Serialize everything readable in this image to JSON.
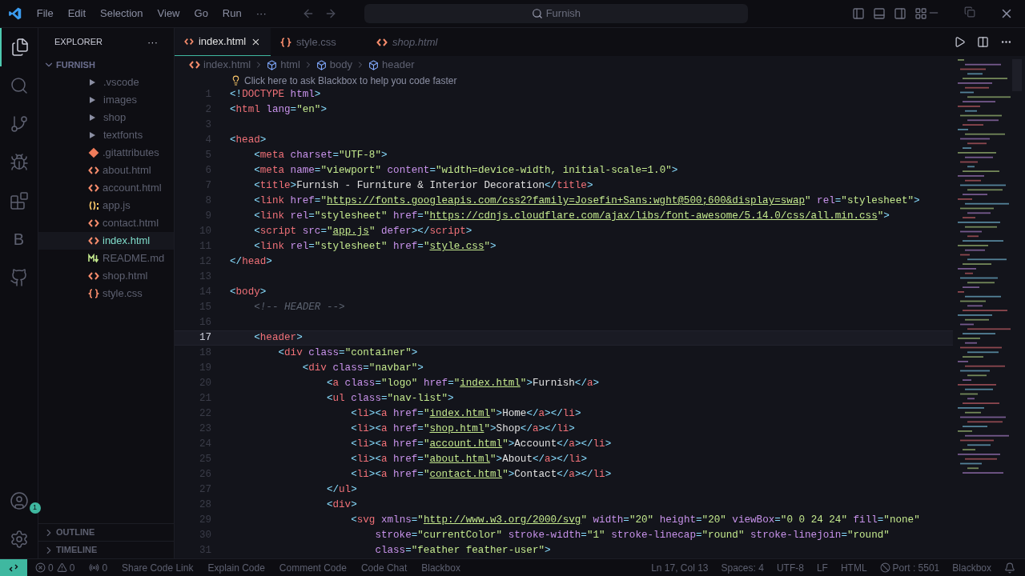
{
  "menu": [
    "File",
    "Edit",
    "Selection",
    "View",
    "Go",
    "Run",
    "···"
  ],
  "command_center": "Furnish",
  "activity": {
    "letter": "B",
    "badge": "1"
  },
  "sidebar": {
    "title": "EXPLORER",
    "more": "···",
    "root": {
      "label": "FURNISH",
      "expanded": true
    },
    "folders": [
      {
        "name": ".vscode",
        "expanded": false
      },
      {
        "name": "images",
        "expanded": false
      },
      {
        "name": "shop",
        "expanded": false
      },
      {
        "name": "textfonts",
        "expanded": false
      }
    ],
    "files": [
      {
        "name": ".gitattributes",
        "kind": "git",
        "selected": false
      },
      {
        "name": "about.html",
        "kind": "html",
        "selected": false
      },
      {
        "name": "account.html",
        "kind": "html",
        "selected": false
      },
      {
        "name": "app.js",
        "kind": "js",
        "selected": false
      },
      {
        "name": "contact.html",
        "kind": "html",
        "selected": false
      },
      {
        "name": "index.html",
        "kind": "html",
        "selected": true
      },
      {
        "name": "README.md",
        "kind": "md",
        "selected": false
      },
      {
        "name": "shop.html",
        "kind": "html",
        "selected": false
      },
      {
        "name": "style.css",
        "kind": "css",
        "selected": false
      }
    ],
    "sections": [
      {
        "label": "OUTLINE",
        "expanded": false
      },
      {
        "label": "TIMELINE",
        "expanded": false
      }
    ]
  },
  "tabs": [
    {
      "label": "index.html",
      "kind": "html",
      "selected": true,
      "preview": false
    },
    {
      "label": "style.css",
      "kind": "css",
      "selected": false,
      "preview": false
    },
    {
      "label": "shop.html",
      "kind": "html",
      "selected": false,
      "preview": true
    }
  ],
  "breadcrumb": [
    {
      "label": "index.html",
      "kind": "file"
    },
    {
      "label": "html",
      "kind": "element"
    },
    {
      "label": "body",
      "kind": "element"
    },
    {
      "label": "header",
      "kind": "element"
    }
  ],
  "hint": "Click here to ask Blackbox to help you code faster",
  "lines": [
    {
      "number": "1",
      "current": false,
      "tokens": [
        {
          "kind": "p",
          "text": "<!"
        },
        {
          "kind": "tag",
          "text": "DOCTYPE"
        },
        {
          "kind": "attr",
          "text": " html"
        },
        {
          "kind": "p",
          "text": ">"
        }
      ]
    },
    {
      "number": "2",
      "current": false,
      "tokens": [
        {
          "kind": "p",
          "text": "<"
        },
        {
          "kind": "tag",
          "text": "html"
        },
        {
          "kind": "attr",
          "text": " lang"
        },
        {
          "kind": "p",
          "text": "="
        },
        {
          "kind": "str",
          "text": "\"en\""
        },
        {
          "kind": "p",
          "text": ">"
        }
      ]
    },
    {
      "number": "3",
      "current": false
    },
    {
      "number": "4",
      "current": false,
      "tokens": [
        {
          "kind": "p",
          "text": "<"
        },
        {
          "kind": "tag",
          "text": "head"
        },
        {
          "kind": "p",
          "text": ">"
        }
      ]
    },
    {
      "number": "5",
      "current": false,
      "tokens": [
        {
          "kind": "p",
          "text": "    <"
        },
        {
          "kind": "tag",
          "text": "meta"
        },
        {
          "kind": "attr",
          "text": " charset"
        },
        {
          "kind": "p",
          "text": "="
        },
        {
          "kind": "str",
          "text": "\"UTF-8\""
        },
        {
          "kind": "p",
          "text": ">"
        }
      ]
    },
    {
      "number": "6",
      "current": false,
      "tokens": [
        {
          "kind": "p",
          "text": "    <"
        },
        {
          "kind": "tag",
          "text": "meta"
        },
        {
          "kind": "attr",
          "text": " name"
        },
        {
          "kind": "p",
          "text": "="
        },
        {
          "kind": "str",
          "text": "\"viewport\""
        },
        {
          "kind": "attr",
          "text": " content"
        },
        {
          "kind": "p",
          "text": "="
        },
        {
          "kind": "str",
          "text": "\"width=device-width, initial-scale=1.0\""
        },
        {
          "kind": "p",
          "text": ">"
        }
      ]
    },
    {
      "number": "7",
      "current": false,
      "tokens": [
        {
          "kind": "p",
          "text": "    <"
        },
        {
          "kind": "tag",
          "text": "title"
        },
        {
          "kind": "p",
          "text": ">"
        },
        {
          "kind": "text",
          "text": "Furnish - Furniture & Interior Decoration"
        },
        {
          "kind": "p",
          "text": "</"
        },
        {
          "kind": "tag",
          "text": "title"
        },
        {
          "kind": "p",
          "text": ">"
        }
      ]
    },
    {
      "number": "8",
      "current": false,
      "tokens": [
        {
          "kind": "p",
          "text": "    <"
        },
        {
          "kind": "tag",
          "text": "link"
        },
        {
          "kind": "attr",
          "text": " href"
        },
        {
          "kind": "p",
          "text": "="
        },
        {
          "kind": "str",
          "text": "\""
        },
        {
          "kind": "link",
          "text": "https://fonts.googleapis.com/css2?family=Josefin+Sans:wght@500;600&display=swap"
        },
        {
          "kind": "str",
          "text": "\""
        },
        {
          "kind": "attr",
          "text": " rel"
        },
        {
          "kind": "p",
          "text": "="
        },
        {
          "kind": "str",
          "text": "\"stylesheet\""
        },
        {
          "kind": "p",
          "text": ">"
        }
      ]
    },
    {
      "number": "9",
      "current": false,
      "tokens": [
        {
          "kind": "p",
          "text": "    <"
        },
        {
          "kind": "tag",
          "text": "link"
        },
        {
          "kind": "attr",
          "text": " rel"
        },
        {
          "kind": "p",
          "text": "="
        },
        {
          "kind": "str",
          "text": "\"stylesheet\""
        },
        {
          "kind": "attr",
          "text": " href"
        },
        {
          "kind": "p",
          "text": "="
        },
        {
          "kind": "str",
          "text": "\""
        },
        {
          "kind": "link",
          "text": "https://cdnjs.cloudflare.com/ajax/libs/font-awesome/5.14.0/css/all.min.css"
        },
        {
          "kind": "str",
          "text": "\""
        },
        {
          "kind": "p",
          "text": ">"
        }
      ]
    },
    {
      "number": "10",
      "current": false,
      "tokens": [
        {
          "kind": "p",
          "text": "    <"
        },
        {
          "kind": "tag",
          "text": "script"
        },
        {
          "kind": "attr",
          "text": " src"
        },
        {
          "kind": "p",
          "text": "="
        },
        {
          "kind": "str",
          "text": "\""
        },
        {
          "kind": "link",
          "text": "app.js"
        },
        {
          "kind": "str",
          "text": "\""
        },
        {
          "kind": "attr",
          "text": " defer"
        },
        {
          "kind": "p",
          "text": "></"
        },
        {
          "kind": "tag",
          "text": "script"
        },
        {
          "kind": "p",
          "text": ">"
        }
      ]
    },
    {
      "number": "11",
      "current": false,
      "tokens": [
        {
          "kind": "p",
          "text": "    <"
        },
        {
          "kind": "tag",
          "text": "link"
        },
        {
          "kind": "attr",
          "text": " rel"
        },
        {
          "kind": "p",
          "text": "="
        },
        {
          "kind": "str",
          "text": "\"stylesheet\""
        },
        {
          "kind": "attr",
          "text": " href"
        },
        {
          "kind": "p",
          "text": "="
        },
        {
          "kind": "str",
          "text": "\""
        },
        {
          "kind": "link",
          "text": "style.css"
        },
        {
          "kind": "str",
          "text": "\""
        },
        {
          "kind": "p",
          "text": ">"
        }
      ]
    },
    {
      "number": "12",
      "current": false,
      "tokens": [
        {
          "kind": "p",
          "text": "</"
        },
        {
          "kind": "tag",
          "text": "head"
        },
        {
          "kind": "p",
          "text": ">"
        }
      ]
    },
    {
      "number": "13",
      "current": false
    },
    {
      "number": "14",
      "current": false,
      "tokens": [
        {
          "kind": "p",
          "text": "<"
        },
        {
          "kind": "tag",
          "text": "body"
        },
        {
          "kind": "p",
          "text": ">"
        }
      ]
    },
    {
      "number": "15",
      "current": false,
      "tokens": [
        {
          "kind": "comment",
          "text": "    <!-- HEADER -->"
        }
      ]
    },
    {
      "number": "16",
      "current": false
    },
    {
      "number": "17",
      "current": true,
      "tokens": [
        {
          "kind": "p",
          "text": "    <"
        },
        {
          "kind": "tag",
          "text": "header"
        },
        {
          "kind": "p",
          "text": ">"
        }
      ]
    },
    {
      "number": "18",
      "current": false,
      "tokens": [
        {
          "kind": "p",
          "text": "        <"
        },
        {
          "kind": "tag",
          "text": "div"
        },
        {
          "kind": "attr",
          "text": " class"
        },
        {
          "kind": "p",
          "text": "="
        },
        {
          "kind": "str",
          "text": "\"container\""
        },
        {
          "kind": "p",
          "text": ">"
        }
      ]
    },
    {
      "number": "19",
      "current": false,
      "tokens": [
        {
          "kind": "p",
          "text": "            <"
        },
        {
          "kind": "tag",
          "text": "div"
        },
        {
          "kind": "attr",
          "text": " class"
        },
        {
          "kind": "p",
          "text": "="
        },
        {
          "kind": "str",
          "text": "\"navbar\""
        },
        {
          "kind": "p",
          "text": ">"
        }
      ]
    },
    {
      "number": "20",
      "current": false,
      "tokens": [
        {
          "kind": "p",
          "text": "                <"
        },
        {
          "kind": "tag",
          "text": "a"
        },
        {
          "kind": "attr",
          "text": " class"
        },
        {
          "kind": "p",
          "text": "="
        },
        {
          "kind": "str",
          "text": "\"logo\""
        },
        {
          "kind": "attr",
          "text": " href"
        },
        {
          "kind": "p",
          "text": "="
        },
        {
          "kind": "str",
          "text": "\""
        },
        {
          "kind": "link",
          "text": "index.html"
        },
        {
          "kind": "str",
          "text": "\""
        },
        {
          "kind": "p",
          "text": ">"
        },
        {
          "kind": "text",
          "text": "Furnish"
        },
        {
          "kind": "p",
          "text": "</"
        },
        {
          "kind": "tag",
          "text": "a"
        },
        {
          "kind": "p",
          "text": ">"
        }
      ]
    },
    {
      "number": "21",
      "current": false,
      "tokens": [
        {
          "kind": "p",
          "text": "                <"
        },
        {
          "kind": "tag",
          "text": "ul"
        },
        {
          "kind": "attr",
          "text": " class"
        },
        {
          "kind": "p",
          "text": "="
        },
        {
          "kind": "str",
          "text": "\"nav-list\""
        },
        {
          "kind": "p",
          "text": ">"
        }
      ]
    },
    {
      "number": "22",
      "current": false,
      "tokens": [
        {
          "kind": "p",
          "text": "                    <"
        },
        {
          "kind": "tag",
          "text": "li"
        },
        {
          "kind": "p",
          "text": "><"
        },
        {
          "kind": "tag",
          "text": "a"
        },
        {
          "kind": "attr",
          "text": " href"
        },
        {
          "kind": "p",
          "text": "="
        },
        {
          "kind": "str",
          "text": "\""
        },
        {
          "kind": "link",
          "text": "index.html"
        },
        {
          "kind": "str",
          "text": "\""
        },
        {
          "kind": "p",
          "text": ">"
        },
        {
          "kind": "text",
          "text": "Home"
        },
        {
          "kind": "p",
          "text": "</"
        },
        {
          "kind": "tag",
          "text": "a"
        },
        {
          "kind": "p",
          "text": "></"
        },
        {
          "kind": "tag",
          "text": "li"
        },
        {
          "kind": "p",
          "text": ">"
        }
      ]
    },
    {
      "number": "23",
      "current": false,
      "tokens": [
        {
          "kind": "p",
          "text": "                    <"
        },
        {
          "kind": "tag",
          "text": "li"
        },
        {
          "kind": "p",
          "text": "><"
        },
        {
          "kind": "tag",
          "text": "a"
        },
        {
          "kind": "attr",
          "text": " href"
        },
        {
          "kind": "p",
          "text": "="
        },
        {
          "kind": "str",
          "text": "\""
        },
        {
          "kind": "link",
          "text": "shop.html"
        },
        {
          "kind": "str",
          "text": "\""
        },
        {
          "kind": "p",
          "text": ">"
        },
        {
          "kind": "text",
          "text": "Shop"
        },
        {
          "kind": "p",
          "text": "</"
        },
        {
          "kind": "tag",
          "text": "a"
        },
        {
          "kind": "p",
          "text": "></"
        },
        {
          "kind": "tag",
          "text": "li"
        },
        {
          "kind": "p",
          "text": ">"
        }
      ]
    },
    {
      "number": "24",
      "current": false,
      "tokens": [
        {
          "kind": "p",
          "text": "                    <"
        },
        {
          "kind": "tag",
          "text": "li"
        },
        {
          "kind": "p",
          "text": "><"
        },
        {
          "kind": "tag",
          "text": "a"
        },
        {
          "kind": "attr",
          "text": " href"
        },
        {
          "kind": "p",
          "text": "="
        },
        {
          "kind": "str",
          "text": "\""
        },
        {
          "kind": "link",
          "text": "account.html"
        },
        {
          "kind": "str",
          "text": "\""
        },
        {
          "kind": "p",
          "text": ">"
        },
        {
          "kind": "text",
          "text": "Account"
        },
        {
          "kind": "p",
          "text": "</"
        },
        {
          "kind": "tag",
          "text": "a"
        },
        {
          "kind": "p",
          "text": "></"
        },
        {
          "kind": "tag",
          "text": "li"
        },
        {
          "kind": "p",
          "text": ">"
        }
      ]
    },
    {
      "number": "25",
      "current": false,
      "tokens": [
        {
          "kind": "p",
          "text": "                    <"
        },
        {
          "kind": "tag",
          "text": "li"
        },
        {
          "kind": "p",
          "text": "><"
        },
        {
          "kind": "tag",
          "text": "a"
        },
        {
          "kind": "attr",
          "text": " href"
        },
        {
          "kind": "p",
          "text": "="
        },
        {
          "kind": "str",
          "text": "\""
        },
        {
          "kind": "link",
          "text": "about.html"
        },
        {
          "kind": "str",
          "text": "\""
        },
        {
          "kind": "p",
          "text": ">"
        },
        {
          "kind": "text",
          "text": "About"
        },
        {
          "kind": "p",
          "text": "</"
        },
        {
          "kind": "tag",
          "text": "a"
        },
        {
          "kind": "p",
          "text": "></"
        },
        {
          "kind": "tag",
          "text": "li"
        },
        {
          "kind": "p",
          "text": ">"
        }
      ]
    },
    {
      "number": "26",
      "current": false,
      "tokens": [
        {
          "kind": "p",
          "text": "                    <"
        },
        {
          "kind": "tag",
          "text": "li"
        },
        {
          "kind": "p",
          "text": "><"
        },
        {
          "kind": "tag",
          "text": "a"
        },
        {
          "kind": "attr",
          "text": " href"
        },
        {
          "kind": "p",
          "text": "="
        },
        {
          "kind": "str",
          "text": "\""
        },
        {
          "kind": "link",
          "text": "contact.html"
        },
        {
          "kind": "str",
          "text": "\""
        },
        {
          "kind": "p",
          "text": ">"
        },
        {
          "kind": "text",
          "text": "Contact"
        },
        {
          "kind": "p",
          "text": "</"
        },
        {
          "kind": "tag",
          "text": "a"
        },
        {
          "kind": "p",
          "text": "></"
        },
        {
          "kind": "tag",
          "text": "li"
        },
        {
          "kind": "p",
          "text": ">"
        }
      ]
    },
    {
      "number": "27",
      "current": false,
      "tokens": [
        {
          "kind": "p",
          "text": "                </"
        },
        {
          "kind": "tag",
          "text": "ul"
        },
        {
          "kind": "p",
          "text": ">"
        }
      ]
    },
    {
      "number": "28",
      "current": false,
      "tokens": [
        {
          "kind": "p",
          "text": "                <"
        },
        {
          "kind": "tag",
          "text": "div"
        },
        {
          "kind": "p",
          "text": ">"
        }
      ]
    },
    {
      "number": "29",
      "current": false,
      "tokens": [
        {
          "kind": "p",
          "text": "                    <"
        },
        {
          "kind": "tag",
          "text": "svg"
        },
        {
          "kind": "attr",
          "text": " xmlns"
        },
        {
          "kind": "p",
          "text": "="
        },
        {
          "kind": "str",
          "text": "\""
        },
        {
          "kind": "link",
          "text": "http://www.w3.org/2000/svg"
        },
        {
          "kind": "str",
          "text": "\""
        },
        {
          "kind": "attr",
          "text": " width"
        },
        {
          "kind": "p",
          "text": "="
        },
        {
          "kind": "str",
          "text": "\"20\""
        },
        {
          "kind": "attr",
          "text": " height"
        },
        {
          "kind": "p",
          "text": "="
        },
        {
          "kind": "str",
          "text": "\"20\""
        },
        {
          "kind": "attr",
          "text": " viewBox"
        },
        {
          "kind": "p",
          "text": "="
        },
        {
          "kind": "str",
          "text": "\"0 0 24 24\""
        },
        {
          "kind": "attr",
          "text": " fill"
        },
        {
          "kind": "p",
          "text": "="
        },
        {
          "kind": "str",
          "text": "\"none\""
        }
      ]
    },
    {
      "number": "30",
      "current": false,
      "tokens": [
        {
          "kind": "attr",
          "text": "                        stroke"
        },
        {
          "kind": "p",
          "text": "="
        },
        {
          "kind": "str",
          "text": "\"currentColor\""
        },
        {
          "kind": "attr",
          "text": " stroke-width"
        },
        {
          "kind": "p",
          "text": "="
        },
        {
          "kind": "str",
          "text": "\"1\""
        },
        {
          "kind": "attr",
          "text": " stroke-linecap"
        },
        {
          "kind": "p",
          "text": "="
        },
        {
          "kind": "str",
          "text": "\"round\""
        },
        {
          "kind": "attr",
          "text": " stroke-linejoin"
        },
        {
          "kind": "p",
          "text": "="
        },
        {
          "kind": "str",
          "text": "\"round\""
        }
      ]
    },
    {
      "number": "31",
      "current": false,
      "tokens": [
        {
          "kind": "attr",
          "text": "                        class"
        },
        {
          "kind": "p",
          "text": "="
        },
        {
          "kind": "str",
          "text": "\"feather feather-user\""
        },
        {
          "kind": "p",
          "text": ">"
        }
      ]
    }
  ],
  "status": {
    "left": [
      {
        "kind": "errors",
        "text": "0"
      },
      {
        "kind": "warnings",
        "text": "0"
      },
      {
        "kind": "ports",
        "text": "0"
      },
      {
        "kind": "plain",
        "text": "Share Code Link"
      },
      {
        "kind": "plain",
        "text": "Explain Code"
      },
      {
        "kind": "plain",
        "text": "Comment Code"
      },
      {
        "kind": "plain",
        "text": "Code Chat"
      },
      {
        "kind": "plain",
        "text": "Blackbox"
      }
    ],
    "right": [
      {
        "kind": "plain",
        "text": "Ln 17, Col 13"
      },
      {
        "kind": "plain",
        "text": "Spaces: 4"
      },
      {
        "kind": "plain",
        "text": "UTF-8"
      },
      {
        "kind": "plain",
        "text": "LF"
      },
      {
        "kind": "plain",
        "text": "HTML"
      },
      {
        "kind": "port",
        "text": "Port : 5501"
      },
      {
        "kind": "plain",
        "text": "Blackbox"
      }
    ]
  }
}
